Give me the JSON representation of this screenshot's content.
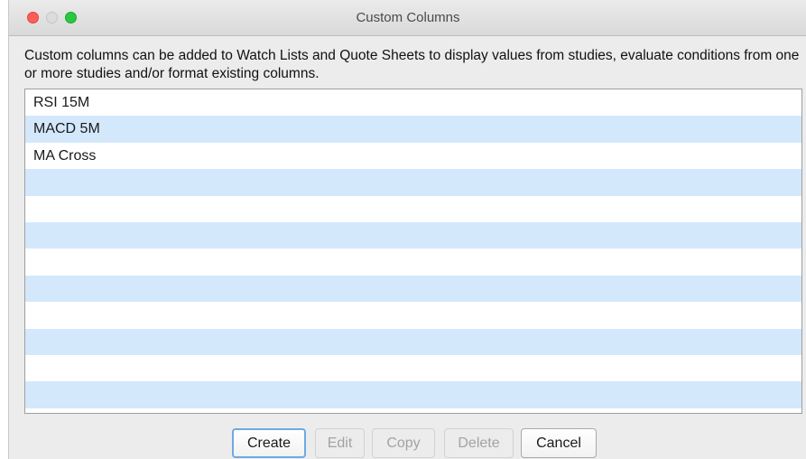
{
  "window": {
    "title": "Custom Columns"
  },
  "description": "Custom columns can be added to Watch Lists and Quote Sheets to display values from studies, evaluate conditions from one or more studies and/or format existing columns.",
  "list": {
    "rows": [
      "RSI 15M",
      "MACD 5M",
      "MA Cross",
      "",
      "",
      "",
      "",
      "",
      "",
      "",
      "",
      ""
    ]
  },
  "buttons": {
    "create": "Create",
    "edit": "Edit",
    "copy": "Copy",
    "delete": "Delete",
    "cancel": "Cancel"
  },
  "colors": {
    "row_alt": "#d4e8fc",
    "default_button_ring": "#6ea9e5",
    "close": "#fd5f57",
    "zoom": "#28c840"
  }
}
